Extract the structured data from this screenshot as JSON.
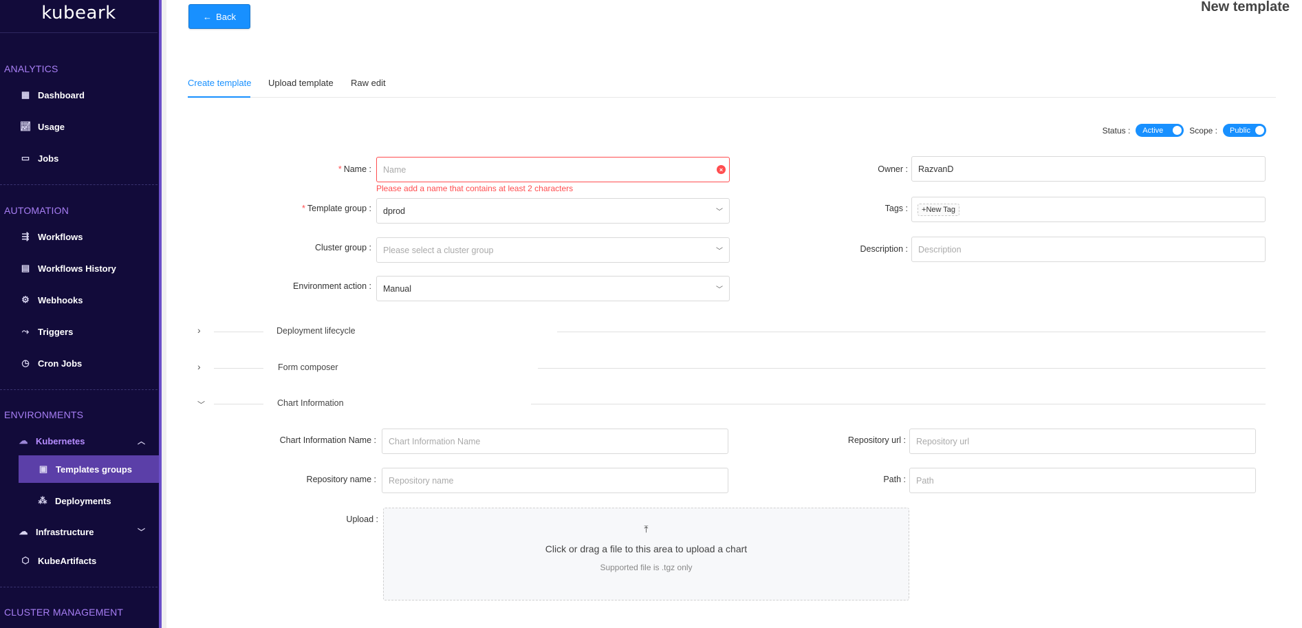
{
  "app": {
    "logo": "kubeark"
  },
  "sidebar": {
    "sections": {
      "analytics": "ANALYTICS",
      "automation": "AUTOMATION",
      "environments": "ENVIRONMENTS",
      "cluster_management": "CLUSTER MANAGEMENT"
    },
    "items": {
      "dashboard": "Dashboard",
      "usage": "Usage",
      "jobs": "Jobs",
      "workflows": "Workflows",
      "workflows_history": "Workflows History",
      "webhooks": "Webhooks",
      "triggers": "Triggers",
      "cron_jobs": "Cron Jobs",
      "kubernetes": "Kubernetes",
      "templates_groups": "Templates groups",
      "deployments": "Deployments",
      "infrastructure": "Infrastructure",
      "kubeartifacts": "KubeArtifacts"
    }
  },
  "header": {
    "back_label": "Back",
    "page_title": "New template"
  },
  "tabs": {
    "create": "Create template",
    "upload": "Upload template",
    "raw": "Raw edit"
  },
  "toggles": {
    "status_label": "Status",
    "status_value": "Active",
    "scope_label": "Scope",
    "scope_value": "Public"
  },
  "form": {
    "name": {
      "label": "Name",
      "placeholder": "Name",
      "error": "Please add a name that contains at least 2 characters"
    },
    "template_group": {
      "label": "Template group",
      "value": "dprod"
    },
    "cluster_group": {
      "label": "Cluster group",
      "placeholder": "Please select a cluster group"
    },
    "environment_action": {
      "label": "Environment action",
      "value": "Manual"
    },
    "owner": {
      "label": "Owner",
      "value": "RazvanD"
    },
    "tags": {
      "label": "Tags",
      "new_tag": "New Tag"
    },
    "description": {
      "label": "Description",
      "placeholder": "Description"
    }
  },
  "sections": {
    "deployment_lifecycle": "Deployment lifecycle",
    "form_composer": "Form composer",
    "chart_information": "Chart Information"
  },
  "chart_info": {
    "name": {
      "label": "Chart Information Name",
      "placeholder": "Chart Information Name"
    },
    "repo_url": {
      "label": "Repository url",
      "placeholder": "Repository url"
    },
    "repo_name": {
      "label": "Repository name",
      "placeholder": "Repository name"
    },
    "path": {
      "label": "Path",
      "placeholder": "Path"
    },
    "upload": {
      "label": "Upload",
      "main": "Click or drag a file to this area to upload a chart",
      "sub": "Supported file is .tgz only"
    }
  },
  "colors": {
    "sidebar_bg": "#120b3a",
    "accent": "#1890ff",
    "section_title": "#a87ff5",
    "error": "#ff4d4f",
    "active_item": "#5b3fa8"
  }
}
